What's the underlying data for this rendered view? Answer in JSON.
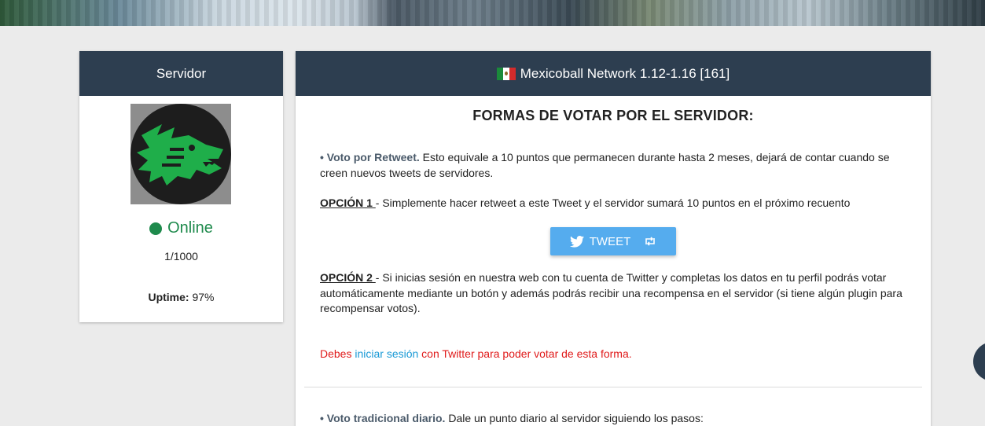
{
  "server_card": {
    "title": "Servidor",
    "status": "Online",
    "players": "1/1000",
    "uptime_label": "Uptime:",
    "uptime_value": "97%"
  },
  "main_card": {
    "title": "Mexicoball Network 1.12-1.16 [161]",
    "section_title": "FORMAS DE VOTAR POR EL SERVIDOR:",
    "retweet_lead": "• Voto por Retweet.",
    "retweet_text": " Esto equivale a 10 puntos que permanecen durante hasta 2 meses, dejará de contar cuando se creen nuevos tweets de servidores.",
    "option1_label": "OPCIÓN 1 ",
    "option1_text": "- Simplemente hacer retweet a este Tweet y el servidor sumará 10 puntos en el próximo recuento",
    "tweet_button": "TWEET",
    "option2_label": "OPCIÓN 2 ",
    "option2_text": "- Si inicias sesión en nuestra web con tu cuenta de Twitter y completas los datos en tu perfil podrás votar automáticamente mediante un botón y además podrás recibir una recompensa en el servidor (si tiene algún plugin para recompensar votos).",
    "login_pre": "Debes ",
    "login_link": "iniciar sesión",
    "login_post": " con Twitter para poder votar de esta forma.",
    "daily_lead": "• Voto tradicional diario.",
    "daily_text": " Dale un punto diario al servidor siguiendo los pasos:"
  },
  "colors": {
    "header_bg": "#2d3e50",
    "online_green": "#1e8a4c",
    "twitter_blue": "#55acee",
    "warning_red": "#e01b1b",
    "link_blue": "#1a9ad6"
  },
  "icons": {
    "flag": "mexico-flag-icon",
    "tweet": "twitter-bird-icon",
    "retweet": "retweet-icon",
    "status": "status-dot-icon"
  }
}
